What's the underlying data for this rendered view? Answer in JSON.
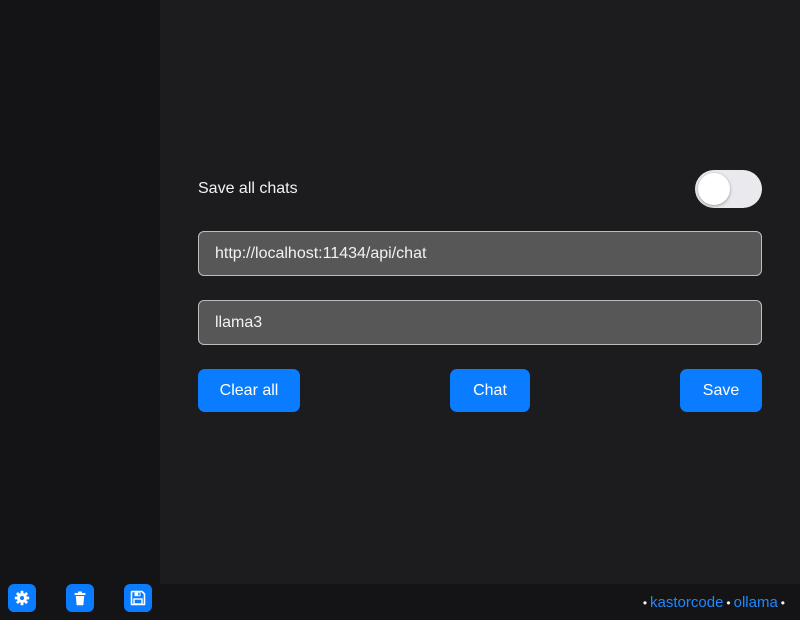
{
  "settings": {
    "save_all_chats_label": "Save all chats",
    "save_all_chats_enabled": false,
    "api_url_value": "http://localhost:11434/api/chat",
    "model_value": "llama3"
  },
  "actions": {
    "clear_all_label": "Clear all",
    "chat_label": "Chat",
    "save_label": "Save"
  },
  "toolbar": {
    "icons": [
      "gear-icon",
      "trash-icon",
      "floppy-disk-icon"
    ]
  },
  "footer": {
    "separator": "•",
    "link_kastorcode": "kastorcode",
    "link_ollama": "ollama"
  },
  "colors": {
    "accent": "#0a7cff",
    "link": "#1e88ff",
    "background": "#1c1c1e",
    "sidebar": "#141416",
    "field": "#575757"
  }
}
